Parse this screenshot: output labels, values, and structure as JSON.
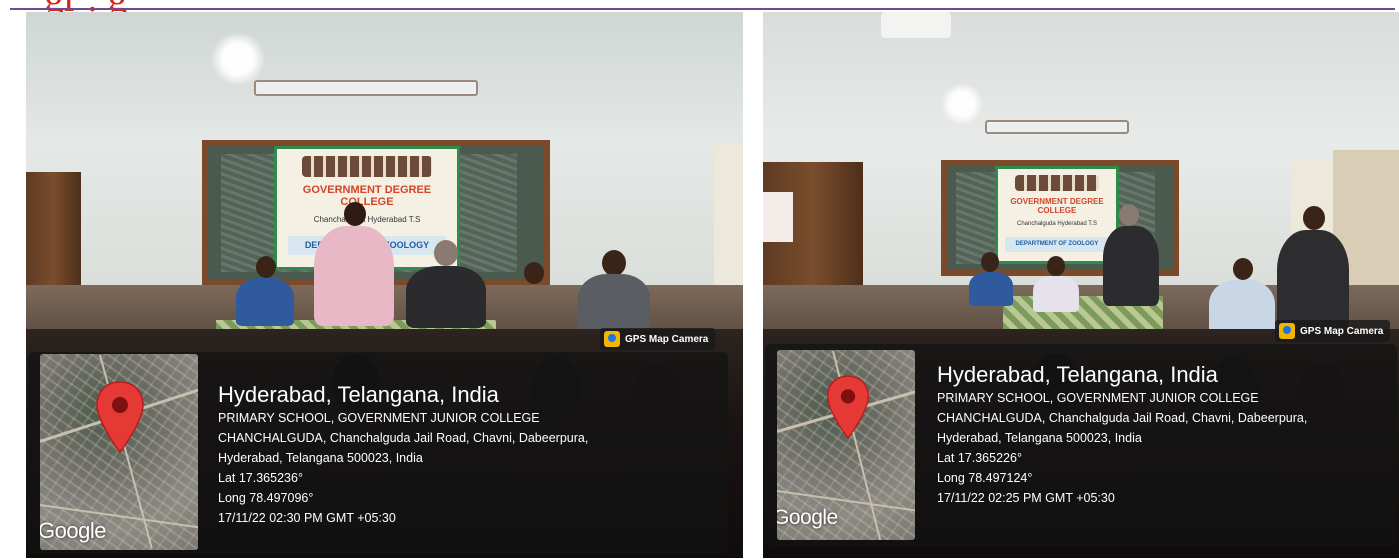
{
  "header": {
    "text": "gr . g"
  },
  "photos": [
    {
      "gps_badge": "GPS Map Camera",
      "title": "Hyderabad, Telangana, India",
      "address_line1": "PRIMARY SCHOOL, GOVERNMENT JUNIOR COLLEGE",
      "address_line2": "CHANCHALGUDA, Chanchalguda Jail Road, Chavni, Dabeerpura,",
      "address_line3": "Hyderabad, Telangana 500023, India",
      "lat": "Lat 17.365236°",
      "long": "Long 78.497096°",
      "datetime": "17/11/22 02:30 PM GMT +05:30",
      "map_logo": "Google",
      "banner_text": "GOVERNMENT DEGREE COLLEGE",
      "banner_dept": "DEPARTMENT OF ZOOLOGY",
      "banner_place": "Chanchalguda Hyderabad T.S"
    },
    {
      "gps_badge": "GPS Map Camera",
      "title": "Hyderabad, Telangana, India",
      "address_line1": "PRIMARY SCHOOL, GOVERNMENT JUNIOR COLLEGE",
      "address_line2": "CHANCHALGUDA, Chanchalguda Jail Road, Chavni, Dabeerpura,",
      "address_line3": "Hyderabad, Telangana 500023, India",
      "lat": "Lat 17.365226°",
      "long": "Long 78.497124°",
      "datetime": "17/11/22 02:25 PM GMT +05:30",
      "map_logo": "Google",
      "banner_text": "GOVERNMENT DEGREE COLLEGE",
      "banner_dept": "DEPARTMENT OF ZOOLOGY",
      "banner_place": "Chanchalguda Hyderabad T.S"
    }
  ],
  "colors": {
    "header_text": "#d9241c",
    "header_line": "#6f4a8e",
    "map_pin": "#e53935"
  },
  "icons": [
    "gps-map-camera-icon",
    "map-pin-icon"
  ]
}
